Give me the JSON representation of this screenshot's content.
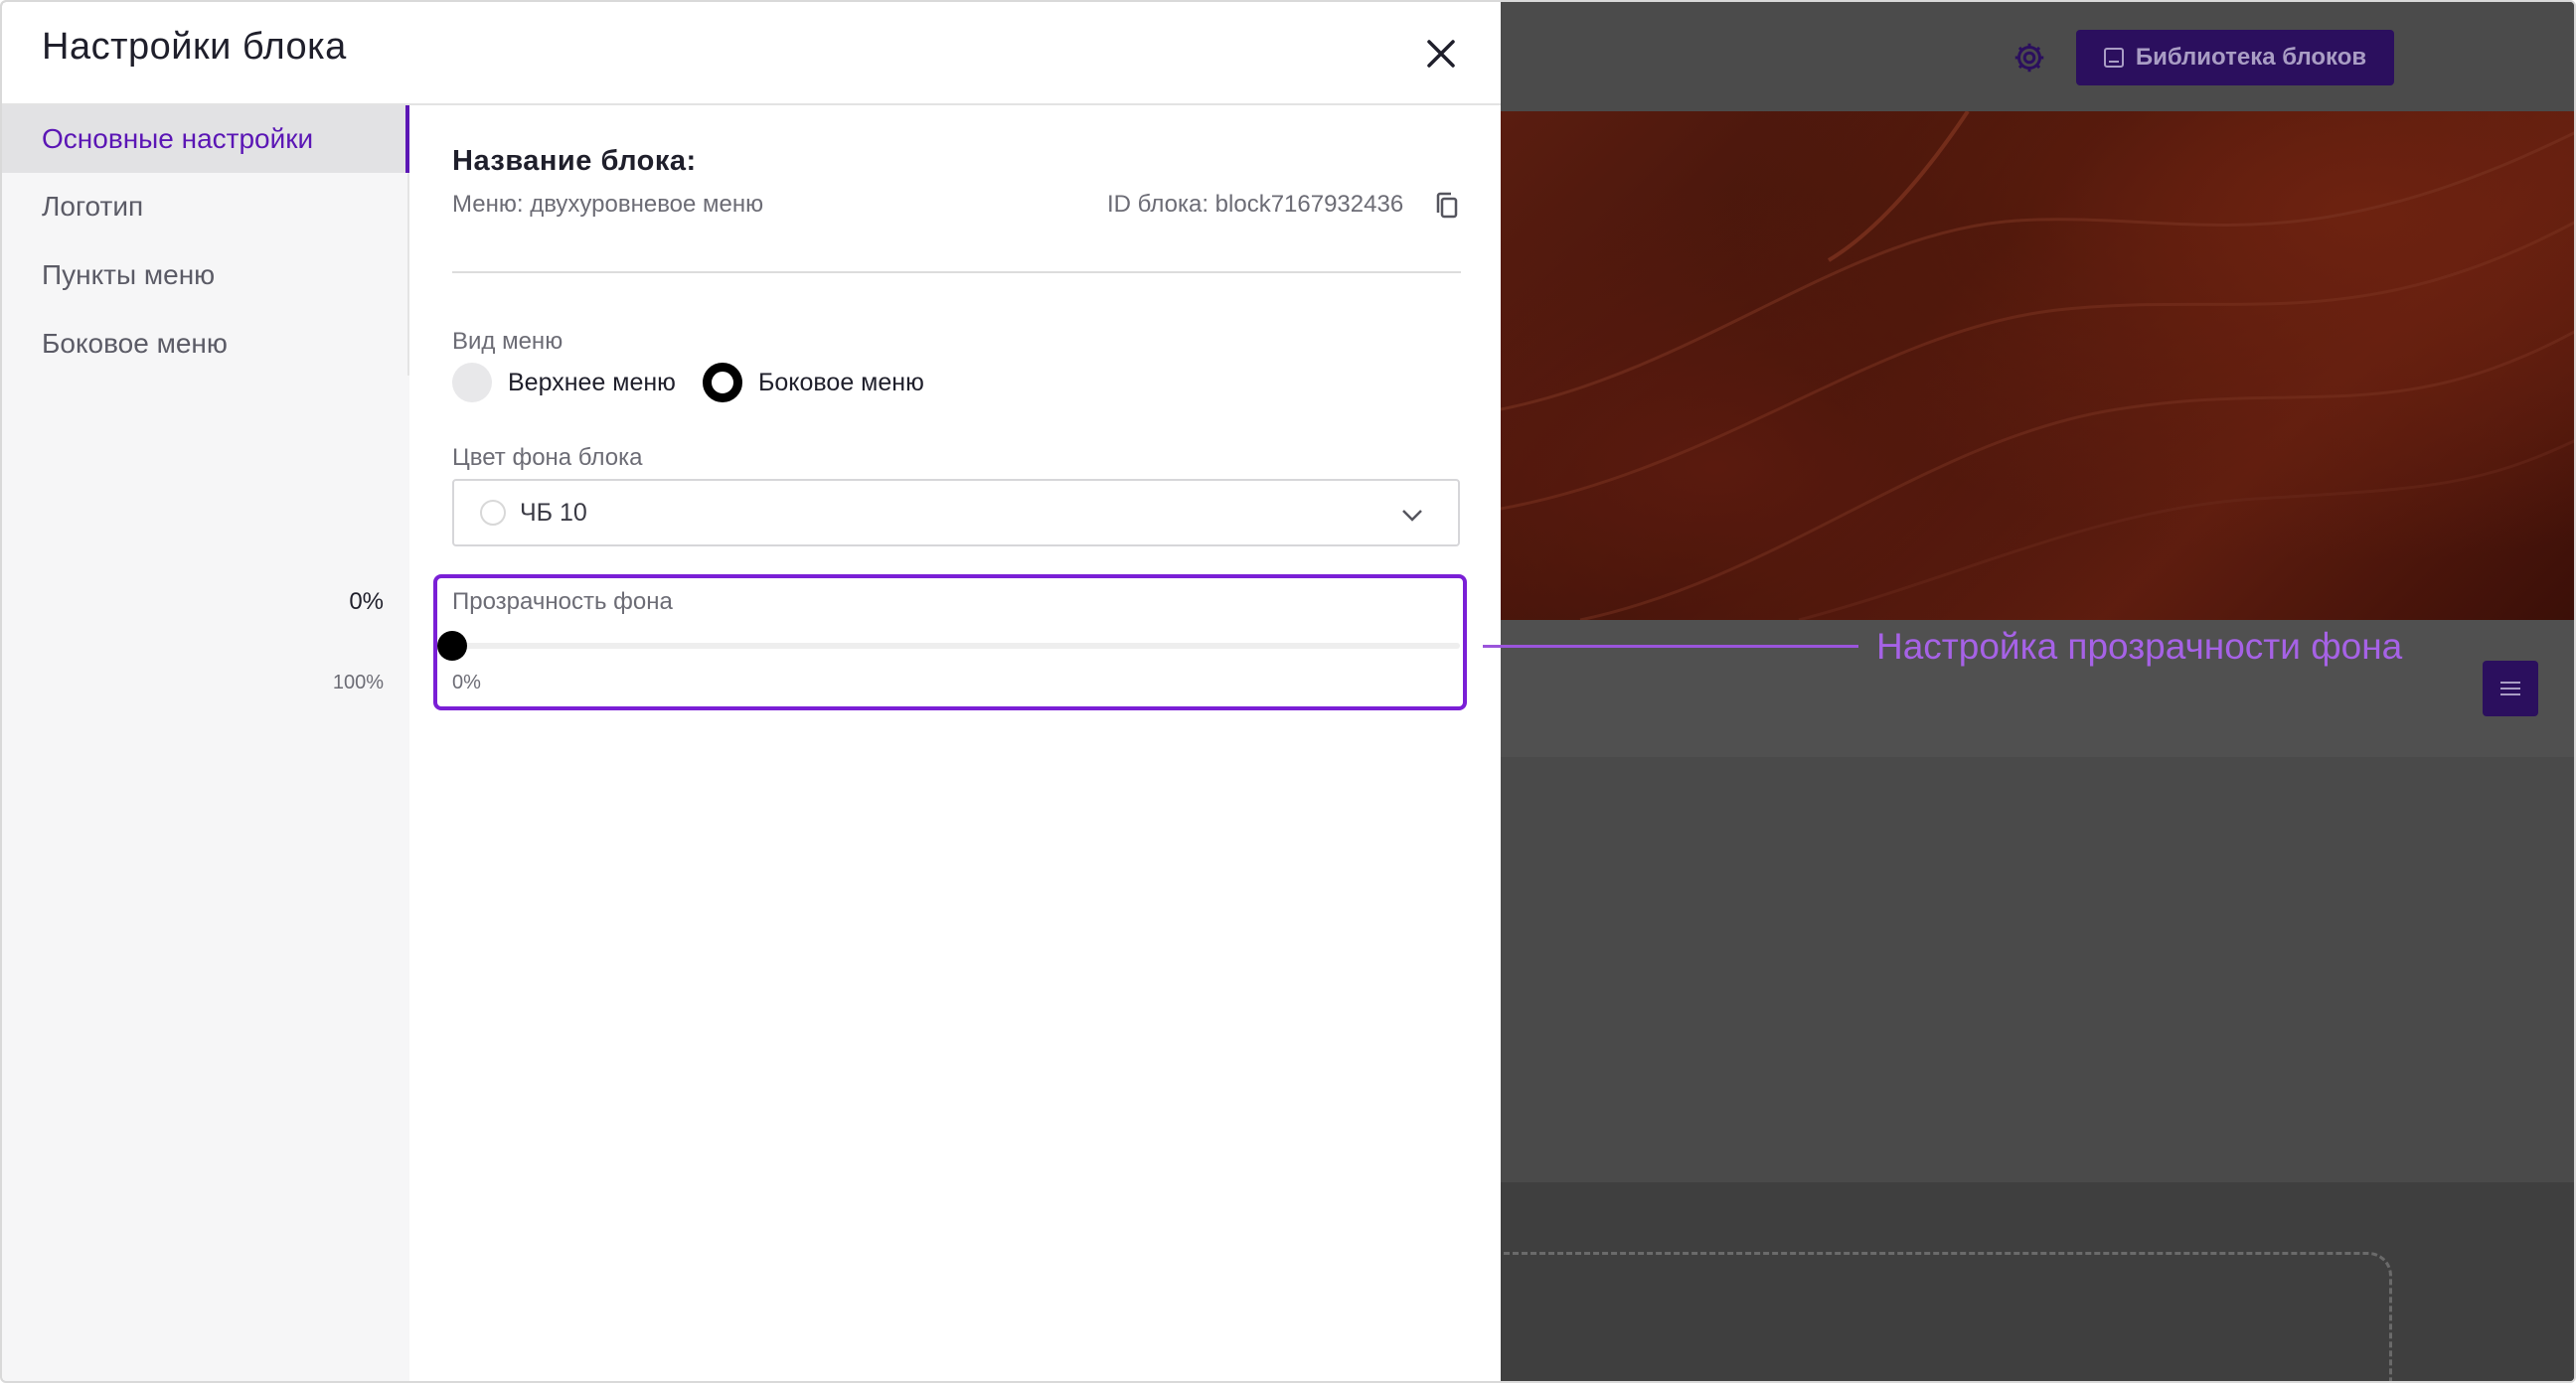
{
  "modal": {
    "title": "Настройки блока",
    "close_icon": "close-icon"
  },
  "sidebar": {
    "items": [
      {
        "label": "Основные настройки",
        "active": true
      },
      {
        "label": "Логотип",
        "active": false
      },
      {
        "label": "Пункты меню",
        "active": false
      },
      {
        "label": "Боковое меню",
        "active": false
      }
    ]
  },
  "block": {
    "name_label": "Название блока:",
    "subtitle": "Меню: двухуровневое меню",
    "id_text": "ID блока: block7167932436",
    "copy_icon": "copy-icon"
  },
  "menu_type": {
    "label": "Вид меню",
    "options": [
      {
        "label": "Верхнее меню",
        "selected": false
      },
      {
        "label": "Боковое меню",
        "selected": true
      }
    ]
  },
  "bg_color": {
    "label": "Цвет фона блока",
    "value": "ЧБ 10"
  },
  "transparency": {
    "label": "Прозрачность фона",
    "value": "0%",
    "min_label": "0%",
    "max_label": "100%",
    "level": 0
  },
  "annotation": {
    "text": "Настройка прозрачности фона",
    "color": "#a662e6"
  },
  "background_editor": {
    "library_button": "Библиотека блоков",
    "settings_icon": "gear-icon",
    "menu_icon": "hamburger-icon"
  },
  "colors": {
    "accent": "#5b16b5",
    "highlight_border": "#7a1fd6",
    "dark_button": "#2b0f5e"
  }
}
